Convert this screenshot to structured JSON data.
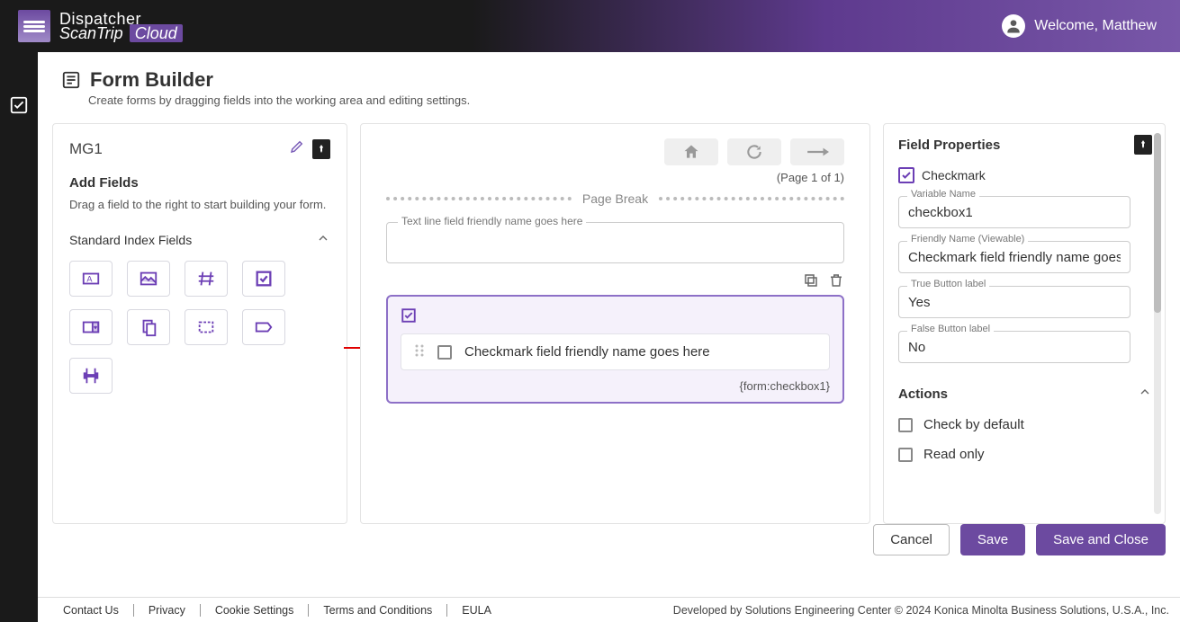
{
  "brand": {
    "line1": "Dispatcher",
    "line2": "ScanTrip",
    "badge": "Cloud"
  },
  "user": {
    "welcome": "Welcome, Matthew"
  },
  "page": {
    "title": "Form Builder",
    "subtitle": "Create forms by dragging fields into the working area and editing settings."
  },
  "leftPanel": {
    "formName": "MG1",
    "addFieldsTitle": "Add Fields",
    "addFieldsHint": "Drag a field to the right to start building your form.",
    "groupTitle": "Standard Index Fields"
  },
  "canvas": {
    "pageIndicator": "(Page 1 of 1)",
    "pageBreakLabel": "Page Break",
    "textFieldLabel": "Text line field friendly name goes here",
    "checkmarkFieldLabel": "Checkmark field friendly name goes here",
    "checkmarkVarRef": "{form:checkbox1}"
  },
  "properties": {
    "title": "Field Properties",
    "typeLabel": "Checkmark",
    "variableNameLabel": "Variable Name",
    "variableNameValue": "checkbox1",
    "friendlyNameLabel": "Friendly Name (Viewable)",
    "friendlyNameValue": "Checkmark field friendly name goes here",
    "trueLabel": "True Button label",
    "trueValue": "Yes",
    "falseLabel": "False Button label",
    "falseValue": "No",
    "actionsTitle": "Actions",
    "action1": "Check by default",
    "action2": "Read only"
  },
  "buttons": {
    "cancel": "Cancel",
    "save": "Save",
    "saveClose": "Save and Close"
  },
  "footer": {
    "links": [
      "Contact Us",
      "Privacy",
      "Cookie Settings",
      "Terms and Conditions",
      "EULA"
    ],
    "copyright": "Developed by Solutions Engineering Center © 2024 Konica Minolta Business Solutions, U.S.A., Inc."
  }
}
